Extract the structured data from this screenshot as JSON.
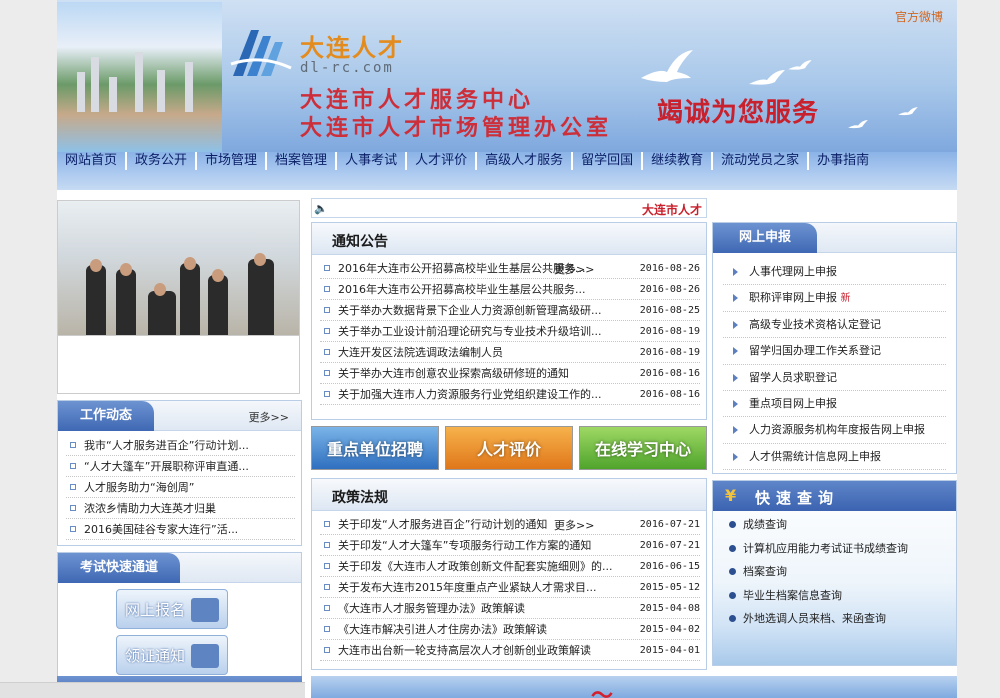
{
  "header": {
    "logo_cn": "大连人才",
    "logo_url": "dl-rc.com",
    "org_line1": "大连市人才服务中心",
    "org_line2": "大连市人才市场管理办公室",
    "slogan": "竭诚为您服务",
    "weibo": "官方微博"
  },
  "nav": [
    "网站首页",
    "政务公开",
    "市场管理",
    "档案管理",
    "人事考试",
    "人才评价",
    "高级人才服务",
    "留学回国",
    "继续教育",
    "流动党员之家",
    "办事指南"
  ],
  "left": {
    "work": {
      "title": "工作动态",
      "more": "更多>>",
      "items": [
        "我市“人才服务进百企”行动计划...",
        "“人才大篷车”开展职称评审直通...",
        "人才服务助力“海创周”",
        "浓浓乡情助力大连英才归巢",
        "2016美国硅谷专家大连行”活..."
      ]
    },
    "exam": {
      "title": "考试快速通道",
      "btn1": "网上报名",
      "btn2": "领证通知"
    }
  },
  "marquee": {
    "text": "大连市人才"
  },
  "notice": {
    "title": "通知公告",
    "more": "更多>>",
    "items": [
      {
        "t": "2016年大连市公开招募高校毕业生基层公共服务...",
        "d": "2016-08-26"
      },
      {
        "t": "2016年大连市公开招募高校毕业生基层公共服务...",
        "d": "2016-08-26"
      },
      {
        "t": "关于举办大数据背景下企业人力资源创新管理高级研...",
        "d": "2016-08-25"
      },
      {
        "t": "关于举办工业设计前沿理论研究与专业技术升级培训...",
        "d": "2016-08-19"
      },
      {
        "t": "大连开发区法院选调政法编制人员",
        "d": "2016-08-19"
      },
      {
        "t": "关于举办大连市创意农业探索高级研修班的通知",
        "d": "2016-08-16"
      },
      {
        "t": "关于加强大连市人力资源服务行业党组织建设工作的...",
        "d": "2016-08-16"
      }
    ]
  },
  "promo": {
    "b1": "重点单位招聘",
    "b2": "人才评价",
    "b3": "在线学习中心"
  },
  "policy": {
    "title": "政策法规",
    "more": "更多>>",
    "items": [
      {
        "t": "关于印发“人才服务进百企”行动计划的通知",
        "d": "2016-07-21"
      },
      {
        "t": "关于印发“人才大篷车”专项服务行动工作方案的通知",
        "d": "2016-07-21"
      },
      {
        "t": "关于印发《大连市人才政策创新文件配套实施细则》的...",
        "d": "2016-06-15"
      },
      {
        "t": "关于发布大连市2015年度重点产业紧缺人才需求目...",
        "d": "2015-05-12"
      },
      {
        "t": "《大连市人才服务管理办法》政策解读",
        "d": "2015-04-08"
      },
      {
        "t": "《大连市解决引进人才住房办法》政策解读",
        "d": "2015-04-02"
      },
      {
        "t": "大连市出台新一轮支持高层次人才创新创业政策解读",
        "d": "2015-04-01"
      }
    ]
  },
  "online": {
    "title": "网上申报",
    "items": [
      "人事代理网上申报",
      "职称评审网上申报",
      "高级专业技术资格认定登记",
      "留学归国办理工作关系登记",
      "留学人员求职登记",
      "重点项目网上申报",
      "人力资源服务机构年度报告网上申报",
      "人才供需统计信息网上申报"
    ],
    "new_badge": "新"
  },
  "quick": {
    "title": "快速查询",
    "items": [
      "成绩查询",
      "计算机应用能力考试证书成绩查询",
      "档案查询",
      "毕业生档案信息查询",
      "外地选调人员来档、来函查询"
    ]
  },
  "colors": {
    "nav_text": "#0b1f66",
    "accent_red": "#c8202c",
    "tab_blue": "#3f68b4"
  }
}
